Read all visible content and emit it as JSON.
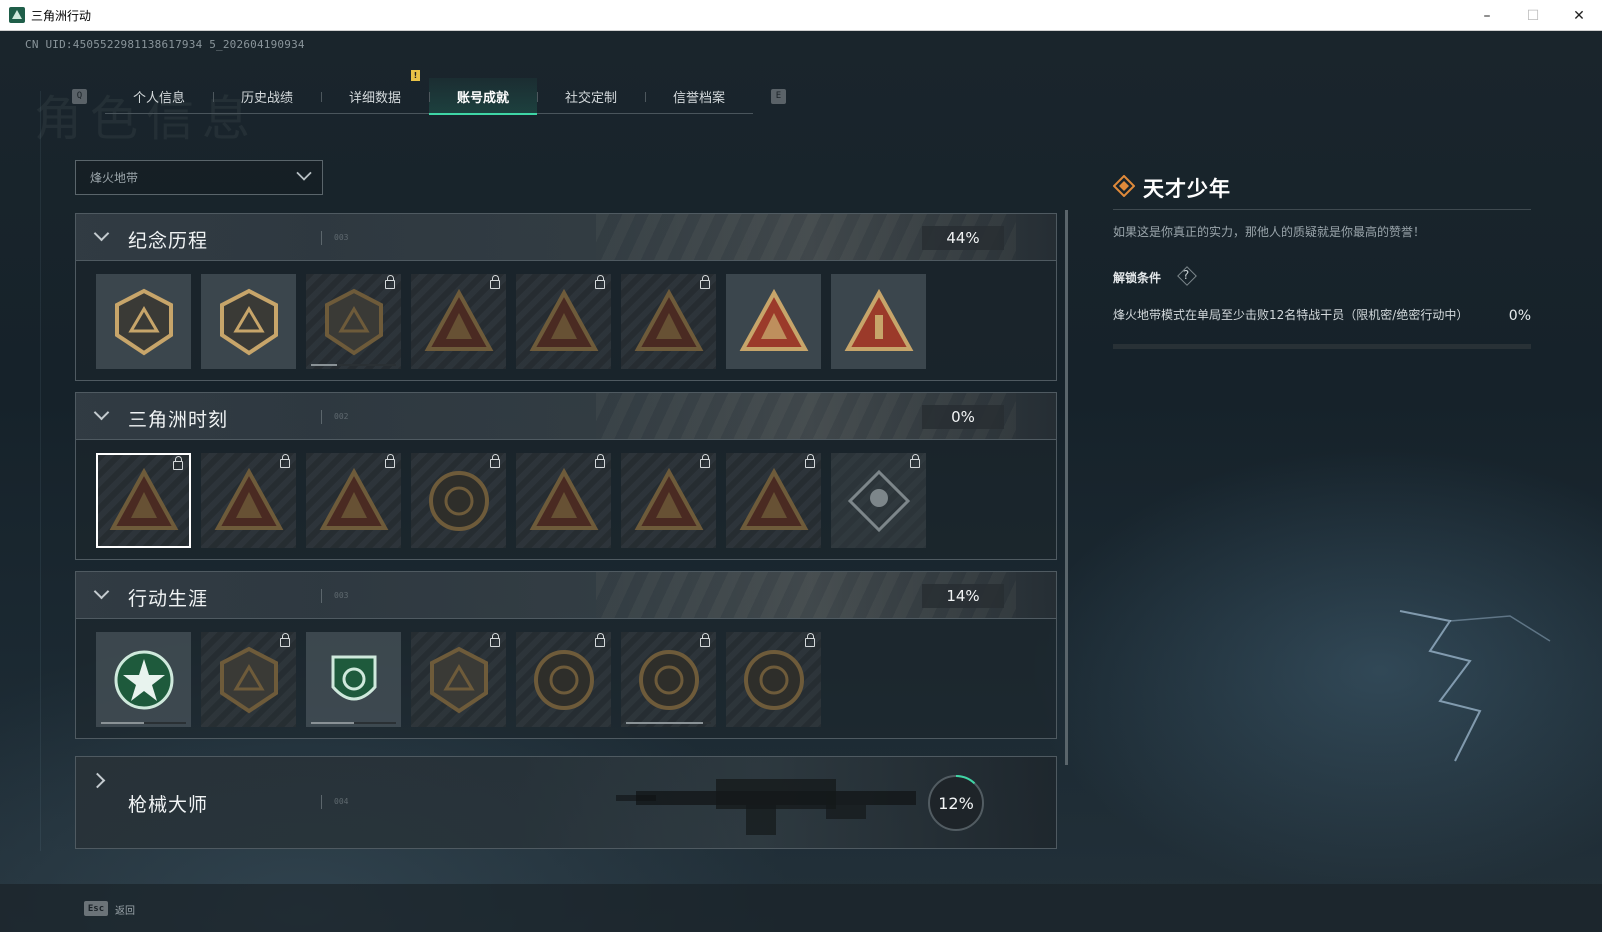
{
  "window": {
    "title": "三角洲行动",
    "minimize": "–",
    "maximize": "☐",
    "close": "✕"
  },
  "uid_text": "CN UID:4505522981138617934 5_202604190934",
  "watermark": "角色信息",
  "tabs": {
    "key_left": "Q",
    "key_right": "E",
    "notice": "!",
    "items": [
      {
        "label": "个人信息"
      },
      {
        "label": "历史战绩"
      },
      {
        "label": "详细数据"
      },
      {
        "label": "账号成就",
        "active": true
      },
      {
        "label": "社交定制"
      },
      {
        "label": "信誉档案"
      }
    ]
  },
  "mode_select": {
    "value": "烽火地带"
  },
  "groups": [
    {
      "title": "纪念历程",
      "code": "003",
      "percent": "44%",
      "badges": [
        {
          "icon": "delta-emblem-icon",
          "locked": false,
          "progress": 0
        },
        {
          "icon": "helicopter-icon",
          "locked": false,
          "progress": 0
        },
        {
          "icon": "shield-crest-icon",
          "locked": true,
          "progress": 0.3
        },
        {
          "icon": "operator-arms-icon",
          "locked": true,
          "progress": 0
        },
        {
          "icon": "hooded-figure-icon",
          "locked": true,
          "progress": 0
        },
        {
          "icon": "crossed-blades-icon",
          "locked": true,
          "progress": 0
        },
        {
          "icon": "wings-triangle-icon",
          "locked": false,
          "progress": 0
        },
        {
          "icon": "number-one-triangle-icon",
          "locked": false,
          "progress": 0
        }
      ]
    },
    {
      "title": "三角洲时刻",
      "code": "002",
      "percent": "0%",
      "badges": [
        {
          "icon": "supply-box-icon",
          "locked": true,
          "selected": true
        },
        {
          "icon": "soldier-badge-icon",
          "locked": true
        },
        {
          "icon": "kneeling-figure-icon",
          "locked": true
        },
        {
          "icon": "gear-eye-icon",
          "locked": true
        },
        {
          "icon": "squad-icon",
          "locked": true
        },
        {
          "icon": "horned-beast-icon",
          "locked": true
        },
        {
          "icon": "dragon-icon",
          "locked": true
        },
        {
          "icon": "diamond-rose-icon",
          "locked": true,
          "faded": true
        }
      ]
    },
    {
      "title": "行动生涯",
      "code": "003",
      "percent": "14%",
      "badges": [
        {
          "icon": "star-wreath-icon",
          "locked": false,
          "progress": 0.5
        },
        {
          "icon": "eagle-shield-icon",
          "locked": true,
          "progress": 0
        },
        {
          "icon": "green-shield-icon",
          "locked": false,
          "progress": 0.5
        },
        {
          "icon": "d20-shield-icon",
          "locked": true,
          "progress": 0
        },
        {
          "icon": "helmet-ring-icon",
          "locked": true,
          "progress": 0
        },
        {
          "icon": "skull-crosshair-icon",
          "locked": true,
          "progress": 0.9
        },
        {
          "icon": "eye-ring-icon",
          "locked": true,
          "progress": 0
        }
      ]
    }
  ],
  "weapon_group": {
    "title": "枪械大师",
    "code": "004",
    "percent": "12%",
    "progress": 0.12
  },
  "detail": {
    "title": "天才少年",
    "description": "如果这是你真正的实力，那他人的质疑就是你最高的赞誉！",
    "unlock_label": "解锁条件",
    "help": "?",
    "condition": "烽火地带模式在单局至少击败12名特战干员（限机密/绝密行动中）",
    "condition_percent": "0%",
    "condition_progress": 0.0
  },
  "footer": {
    "esc_key": "Esc",
    "back_label": "返回"
  },
  "colors": {
    "accent": "#3fd6a6",
    "badge_gold": "#c7a56a",
    "badge_red": "#9b3a2a",
    "detail_icon": "#e08a3a"
  }
}
